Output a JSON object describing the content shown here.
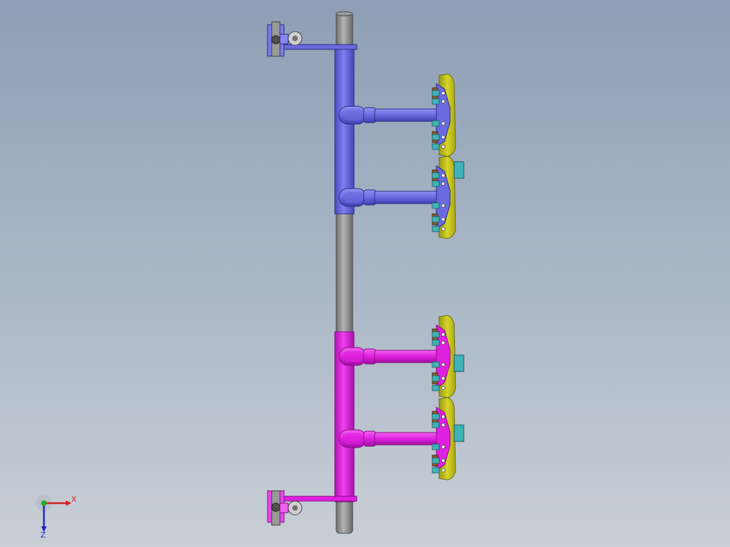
{
  "viewport": {
    "background_top": "#8e9fb5",
    "background_bottom": "#c9cfd6"
  },
  "colors": {
    "shaft": "#8f8f8f",
    "upper_assembly": "#6a6ae0",
    "lower_assembly": "#e020e0",
    "pad": "#c8c820",
    "pad_edge": "#6b6b10",
    "fastener": "#3fb3b8",
    "bracket": "#8b5a2b"
  },
  "triad": {
    "x_label": "X",
    "z_label": "Z",
    "x_color": "#d42020",
    "y_color": "#20b020",
    "z_color": "#2020d4",
    "icon": "coordinate-triad-icon"
  }
}
